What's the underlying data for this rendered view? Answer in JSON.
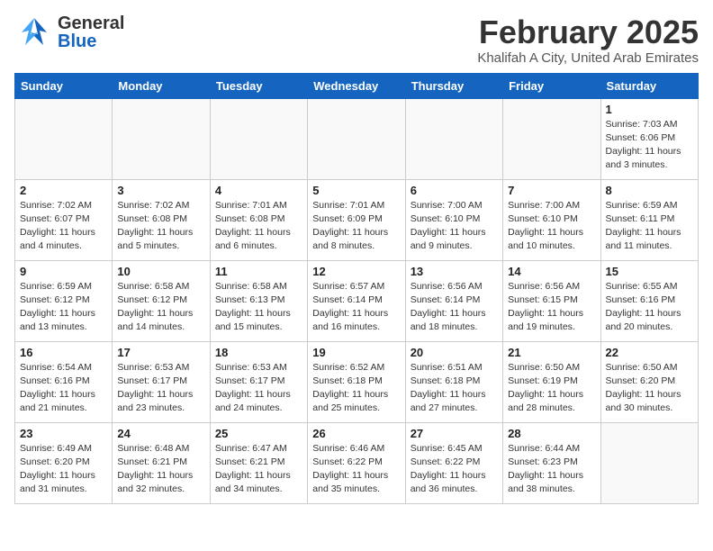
{
  "header": {
    "logo_general": "General",
    "logo_blue": "Blue",
    "month_title": "February 2025",
    "location": "Khalifah A City, United Arab Emirates"
  },
  "calendar": {
    "weekdays": [
      "Sunday",
      "Monday",
      "Tuesday",
      "Wednesday",
      "Thursday",
      "Friday",
      "Saturday"
    ],
    "weeks": [
      [
        {
          "day": "",
          "info": ""
        },
        {
          "day": "",
          "info": ""
        },
        {
          "day": "",
          "info": ""
        },
        {
          "day": "",
          "info": ""
        },
        {
          "day": "",
          "info": ""
        },
        {
          "day": "",
          "info": ""
        },
        {
          "day": "1",
          "info": "Sunrise: 7:03 AM\nSunset: 6:06 PM\nDaylight: 11 hours\nand 3 minutes."
        }
      ],
      [
        {
          "day": "2",
          "info": "Sunrise: 7:02 AM\nSunset: 6:07 PM\nDaylight: 11 hours\nand 4 minutes."
        },
        {
          "day": "3",
          "info": "Sunrise: 7:02 AM\nSunset: 6:08 PM\nDaylight: 11 hours\nand 5 minutes."
        },
        {
          "day": "4",
          "info": "Sunrise: 7:01 AM\nSunset: 6:08 PM\nDaylight: 11 hours\nand 6 minutes."
        },
        {
          "day": "5",
          "info": "Sunrise: 7:01 AM\nSunset: 6:09 PM\nDaylight: 11 hours\nand 8 minutes."
        },
        {
          "day": "6",
          "info": "Sunrise: 7:00 AM\nSunset: 6:10 PM\nDaylight: 11 hours\nand 9 minutes."
        },
        {
          "day": "7",
          "info": "Sunrise: 7:00 AM\nSunset: 6:10 PM\nDaylight: 11 hours\nand 10 minutes."
        },
        {
          "day": "8",
          "info": "Sunrise: 6:59 AM\nSunset: 6:11 PM\nDaylight: 11 hours\nand 11 minutes."
        }
      ],
      [
        {
          "day": "9",
          "info": "Sunrise: 6:59 AM\nSunset: 6:12 PM\nDaylight: 11 hours\nand 13 minutes."
        },
        {
          "day": "10",
          "info": "Sunrise: 6:58 AM\nSunset: 6:12 PM\nDaylight: 11 hours\nand 14 minutes."
        },
        {
          "day": "11",
          "info": "Sunrise: 6:58 AM\nSunset: 6:13 PM\nDaylight: 11 hours\nand 15 minutes."
        },
        {
          "day": "12",
          "info": "Sunrise: 6:57 AM\nSunset: 6:14 PM\nDaylight: 11 hours\nand 16 minutes."
        },
        {
          "day": "13",
          "info": "Sunrise: 6:56 AM\nSunset: 6:14 PM\nDaylight: 11 hours\nand 18 minutes."
        },
        {
          "day": "14",
          "info": "Sunrise: 6:56 AM\nSunset: 6:15 PM\nDaylight: 11 hours\nand 19 minutes."
        },
        {
          "day": "15",
          "info": "Sunrise: 6:55 AM\nSunset: 6:16 PM\nDaylight: 11 hours\nand 20 minutes."
        }
      ],
      [
        {
          "day": "16",
          "info": "Sunrise: 6:54 AM\nSunset: 6:16 PM\nDaylight: 11 hours\nand 21 minutes."
        },
        {
          "day": "17",
          "info": "Sunrise: 6:53 AM\nSunset: 6:17 PM\nDaylight: 11 hours\nand 23 minutes."
        },
        {
          "day": "18",
          "info": "Sunrise: 6:53 AM\nSunset: 6:17 PM\nDaylight: 11 hours\nand 24 minutes."
        },
        {
          "day": "19",
          "info": "Sunrise: 6:52 AM\nSunset: 6:18 PM\nDaylight: 11 hours\nand 25 minutes."
        },
        {
          "day": "20",
          "info": "Sunrise: 6:51 AM\nSunset: 6:18 PM\nDaylight: 11 hours\nand 27 minutes."
        },
        {
          "day": "21",
          "info": "Sunrise: 6:50 AM\nSunset: 6:19 PM\nDaylight: 11 hours\nand 28 minutes."
        },
        {
          "day": "22",
          "info": "Sunrise: 6:50 AM\nSunset: 6:20 PM\nDaylight: 11 hours\nand 30 minutes."
        }
      ],
      [
        {
          "day": "23",
          "info": "Sunrise: 6:49 AM\nSunset: 6:20 PM\nDaylight: 11 hours\nand 31 minutes."
        },
        {
          "day": "24",
          "info": "Sunrise: 6:48 AM\nSunset: 6:21 PM\nDaylight: 11 hours\nand 32 minutes."
        },
        {
          "day": "25",
          "info": "Sunrise: 6:47 AM\nSunset: 6:21 PM\nDaylight: 11 hours\nand 34 minutes."
        },
        {
          "day": "26",
          "info": "Sunrise: 6:46 AM\nSunset: 6:22 PM\nDaylight: 11 hours\nand 35 minutes."
        },
        {
          "day": "27",
          "info": "Sunrise: 6:45 AM\nSunset: 6:22 PM\nDaylight: 11 hours\nand 36 minutes."
        },
        {
          "day": "28",
          "info": "Sunrise: 6:44 AM\nSunset: 6:23 PM\nDaylight: 11 hours\nand 38 minutes."
        },
        {
          "day": "",
          "info": ""
        }
      ]
    ]
  }
}
